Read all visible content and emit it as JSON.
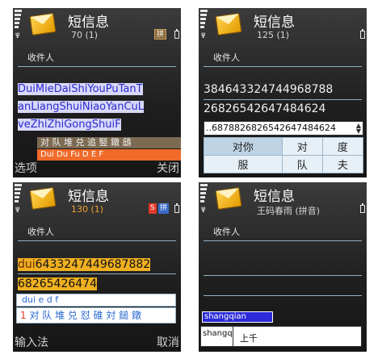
{
  "app_title": "短信息",
  "recipient_label": "收件人",
  "screen1": {
    "count": "70 (1)",
    "mode_badge": "拼",
    "body_lines": [
      "DuiMieDaiShiYouPuTanT",
      "anLiangShuiNiaoYanCuL",
      "veZhiZhiGongShuiF"
    ],
    "candidates": "对 队 堆 兑 追 竪 鐓 鴟",
    "spelling": "Dui Du Fu D E F",
    "softkey_left": "选项",
    "softkey_right": "关闭"
  },
  "screen2": {
    "count": "125 (1)",
    "digit_lines": [
      "384643324744968788",
      "26826542647484624"
    ],
    "input_value": "..6878826826542647484624",
    "grid": [
      [
        "对你",
        "对",
        "度"
      ],
      [
        "服",
        "队",
        "夫"
      ]
    ]
  },
  "screen3": {
    "count": "130 (1)",
    "badge_s": "S",
    "badge_mode": "拼",
    "line1_prefix": "dui",
    "line1_rest": "6433247449687882",
    "line2": "68265426474",
    "spelling_row": "dui e d f",
    "candidate_index": "1",
    "candidates": "对 队 堆 兑 怼 碓 対 鎚 鐓",
    "softkey_left": "输入法",
    "softkey_right": "取消"
  },
  "screen4": {
    "count": "王码春雨 (拼音)",
    "input_highlight": "shangqian",
    "input_text": "shangq",
    "candidate": "上千"
  }
}
